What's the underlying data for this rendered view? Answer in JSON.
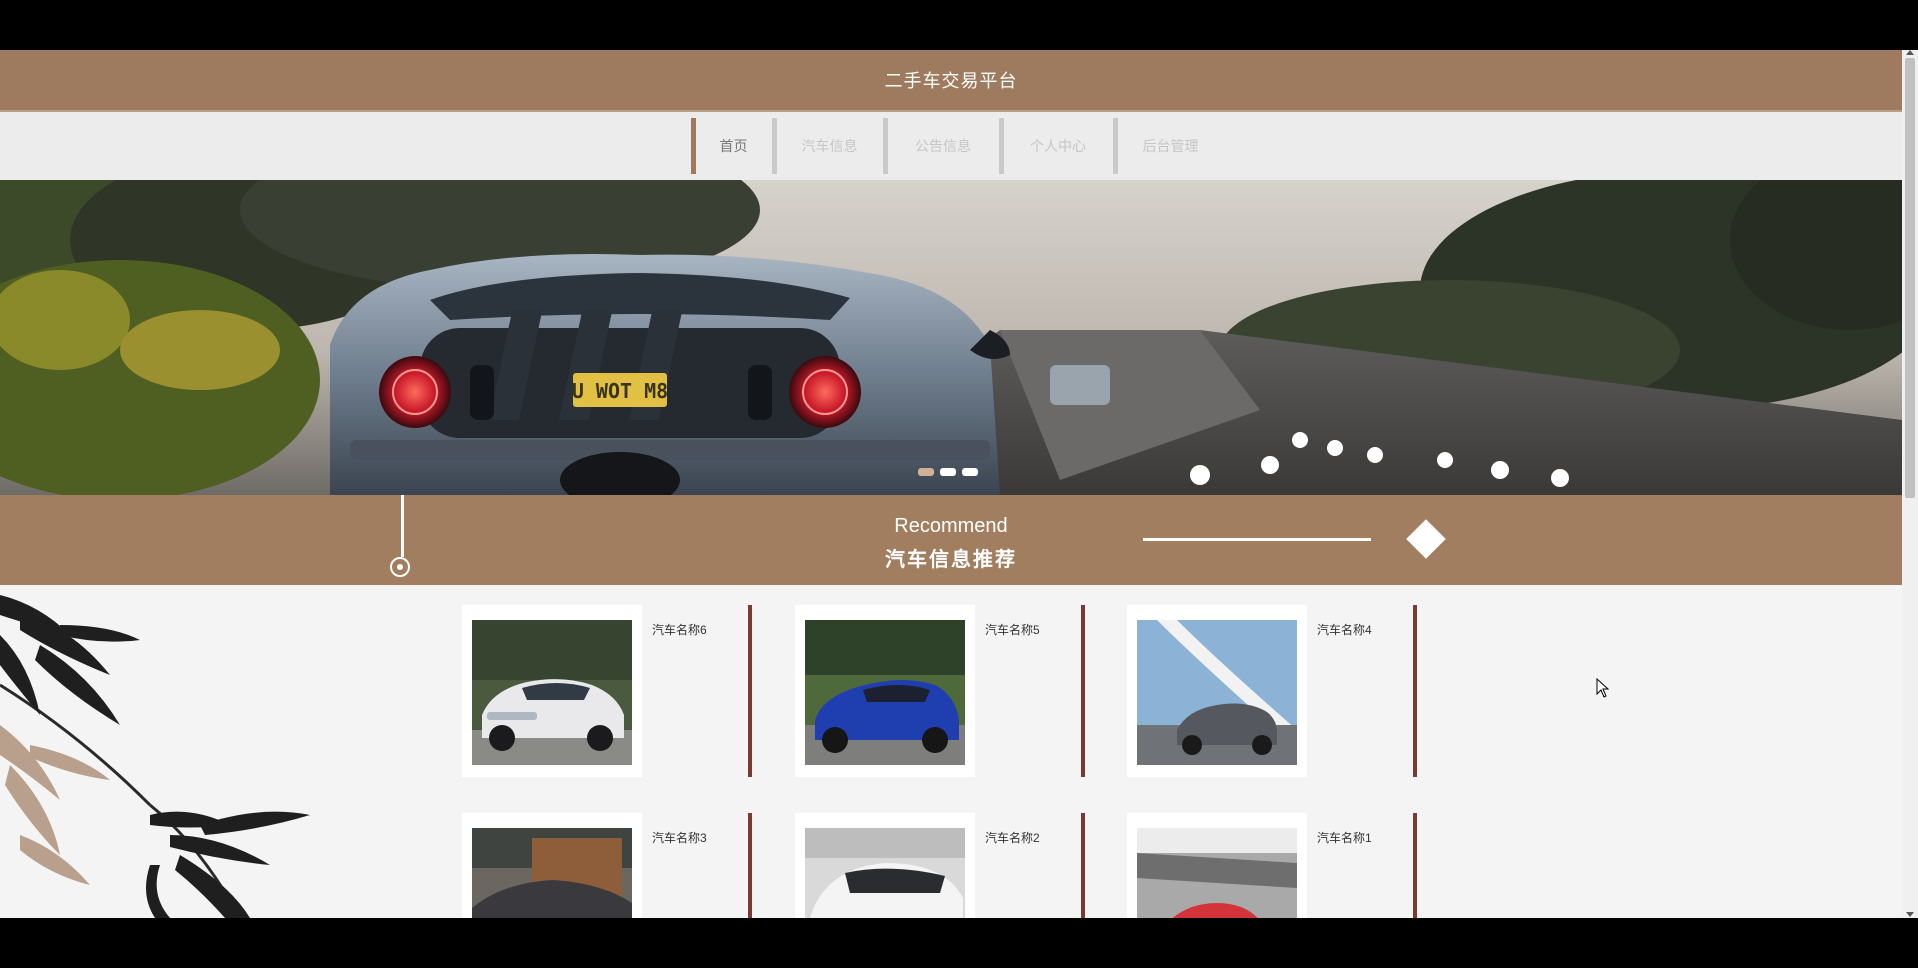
{
  "header": {
    "title": "二手车交易平台"
  },
  "nav": {
    "items": [
      {
        "label": "首页",
        "active": true
      },
      {
        "label": "汽车信息",
        "active": false
      },
      {
        "label": "公告信息",
        "active": false
      },
      {
        "label": "个人中心",
        "active": false
      },
      {
        "label": "后台管理",
        "active": false
      }
    ]
  },
  "banner": {
    "plate_text": "U WOT M8",
    "slides_total": 3,
    "active_slide": 1
  },
  "recommend": {
    "title_en": "Recommend",
    "title_cn": "汽车信息推荐"
  },
  "cars": [
    {
      "name": "汽车名称6",
      "color": "#e9e9ec"
    },
    {
      "name": "汽车名称5",
      "color": "#1f3fb0"
    },
    {
      "name": "汽车名称4",
      "color": "#55595f"
    },
    {
      "name": "汽车名称3",
      "color": "#3a3a3e"
    },
    {
      "name": "汽车名称2",
      "color": "#f4f4f4"
    },
    {
      "name": "汽车名称1",
      "color": "#d2343a"
    }
  ],
  "colors": {
    "brand": "#9e7b5e",
    "recommend_band": "#a27e60",
    "card_divider": "#7a3a32"
  }
}
